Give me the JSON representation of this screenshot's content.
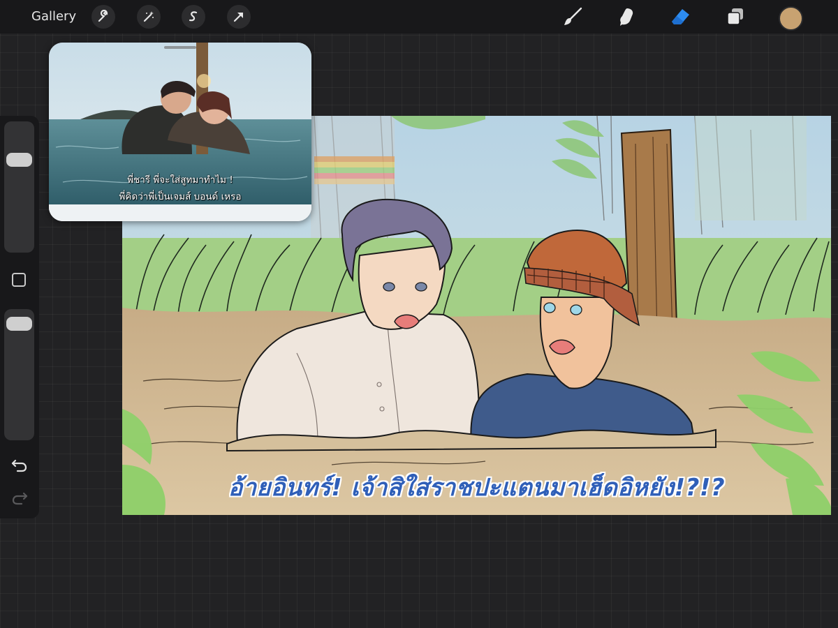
{
  "app": {
    "gallery_label": "Gallery"
  },
  "toolbar": {
    "left_tools": [
      "wrench-icon",
      "magic-wand-icon",
      "selection-icon",
      "transform-arrow-icon"
    ],
    "right_tools": [
      "brush-icon",
      "smudge-icon",
      "eraser-icon",
      "layers-icon"
    ],
    "active_tool": "eraser",
    "current_color": "#c8a271",
    "accent": "#2d8cf0"
  },
  "sidebar": {
    "brush_size_level": 0.26,
    "opacity_level": 0.05
  },
  "reference": {
    "subtitle_line1": "พี่ชารี พี่จะใส่สูทมาทำไม !",
    "subtitle_line2": "พี่คิดว่าพี่เป็นเจมส์ บอนด์ เหรอ"
  },
  "canvas": {
    "caption": "อ้ายอินทร์! เจ้าสิใส่ราชปะแตนมาเฮ็ดอิหยัง!?!?",
    "caption_color": "#2f5fb8"
  }
}
